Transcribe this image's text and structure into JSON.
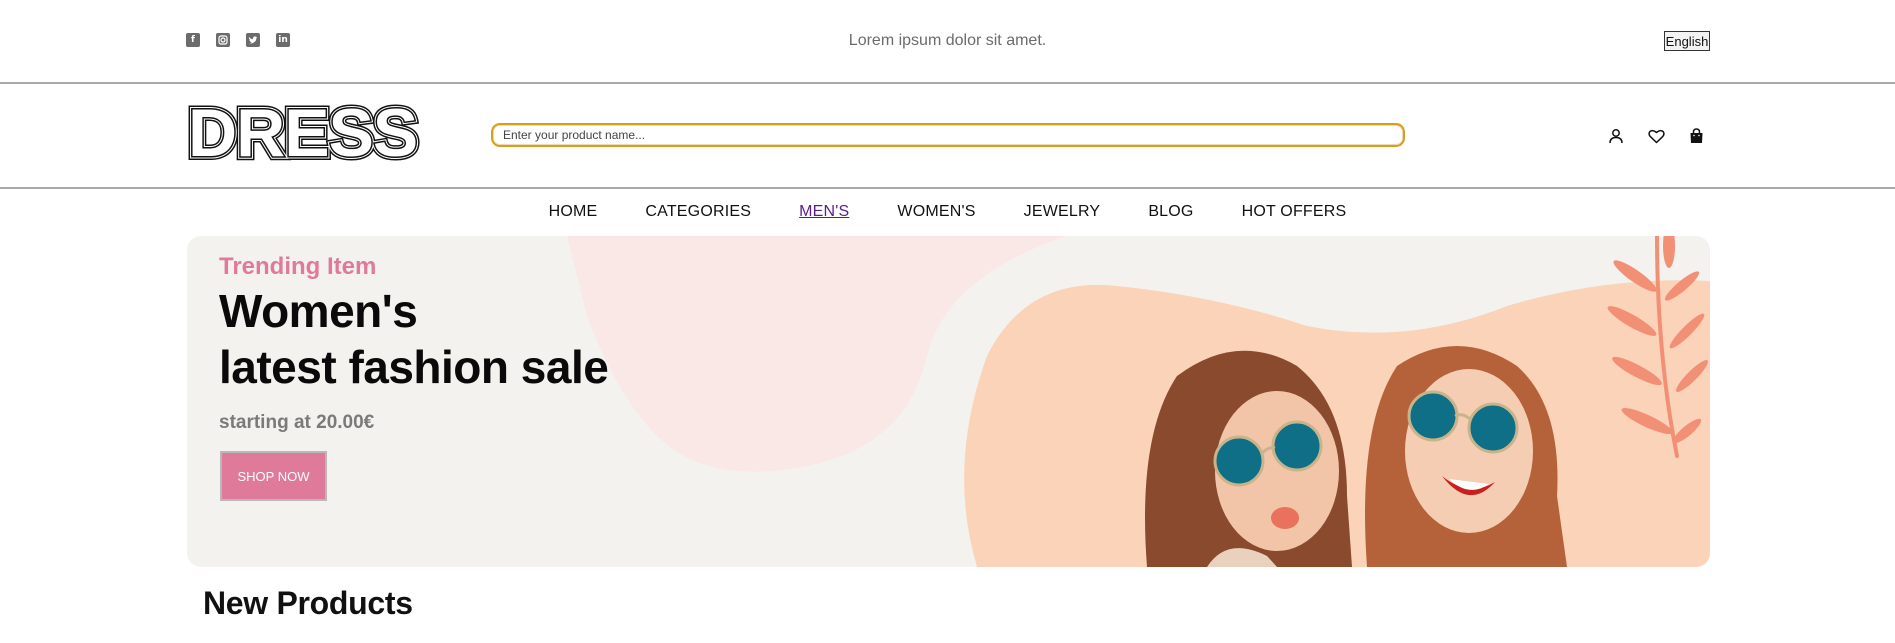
{
  "topbar": {
    "social_icons": [
      "facebook-icon",
      "instagram-icon",
      "twitter-icon",
      "linkedin-icon"
    ],
    "tagline": "Lorem ipsum dolor sit amet.",
    "language": "English"
  },
  "header": {
    "logo_text": "DRESS",
    "search_placeholder": "Enter your product name...",
    "icons": [
      "user-icon",
      "heart-icon",
      "bag-icon"
    ]
  },
  "nav": {
    "items": [
      {
        "label": "HOME"
      },
      {
        "label": "CATEGORIES"
      },
      {
        "label": "MEN'S"
      },
      {
        "label": "WOMEN'S"
      },
      {
        "label": "JEWELRY"
      },
      {
        "label": "BLOG"
      },
      {
        "label": "HOT OFFERS"
      }
    ],
    "active": "MEN'S"
  },
  "banner": {
    "kicker": "Trending Item",
    "title_line1": "Women's",
    "title_line2": "latest fashion sale",
    "price_text": "starting at 20.00€",
    "button_label": "SHOP NOW"
  },
  "section": {
    "title": "New Products"
  },
  "colors": {
    "accent_pink": "#e07a9a",
    "search_border": "#d4a017",
    "active_link": "#5a1d8c",
    "banner_bg": "#f4f2ef",
    "peach": "#fbd3b9",
    "coral": "#f29076"
  }
}
